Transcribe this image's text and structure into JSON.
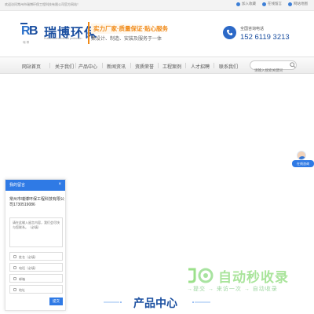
{
  "topbar": {
    "welcome": "欢迎访问常州市瑞博环保工程科技有限公司官方网站！",
    "links": [
      {
        "label": "加入收藏",
        "icon": "star-icon"
      },
      {
        "label": "在线留言",
        "icon": "message-icon"
      },
      {
        "label": "网站地图",
        "icon": "sitemap-icon"
      }
    ]
  },
  "brand": {
    "logo_mark": "RB",
    "logo_caption": "瑞 博",
    "name": "瑞博环保",
    "sub": "Ruibo environmental protection",
    "slogan_main": "实力厂家·质量保证·贴心服务",
    "slogan_sub": "集设计、制造、安装及服务于一体"
  },
  "hotline": {
    "label": "全国咨询电话",
    "number": "152 6119 3213"
  },
  "nav": {
    "items": [
      "网站首页",
      "关于我们",
      "产品中心",
      "新闻资讯",
      "资质荣誉",
      "工程案例",
      "人才招聘",
      "联系我们"
    ],
    "search_placeholder": "请输入搜索关键词"
  },
  "consult_badge": "在线咨询",
  "panel": {
    "title": "我的留言",
    "close": "×",
    "company": "常州市瑞博环保工程科技有限公司1730519086",
    "message_placeholder": "请在此输入留言内容，我们会尽快与您联系。（必填）",
    "fields": [
      {
        "placeholder": "姓名（必填）",
        "icon": "user-icon"
      },
      {
        "placeholder": "电话（必填）",
        "icon": "phone-icon"
      },
      {
        "placeholder": "邮箱",
        "icon": "mail-icon"
      },
      {
        "placeholder": "地址",
        "icon": "location-icon"
      }
    ],
    "submit": "提交"
  },
  "watermark": {
    "text": "自动秒收录",
    "sub": "→提交 → 来访一次 → 自动收录"
  },
  "section_title": "产品中心",
  "colors": {
    "brand_blue": "#1b4fa0",
    "accent_blue": "#2f7ae5",
    "accent_orange": "#f08a18"
  }
}
